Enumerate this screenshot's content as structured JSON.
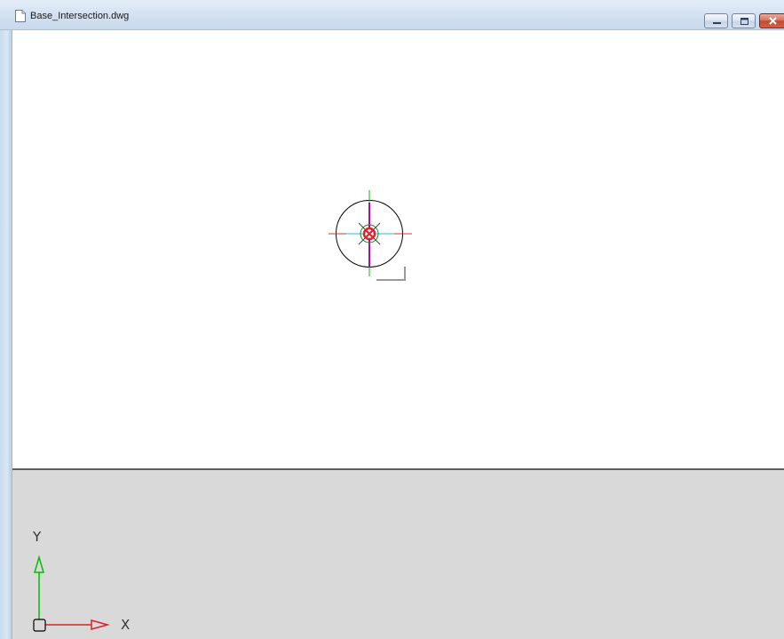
{
  "window": {
    "title": "Base_Intersection.dwg",
    "doc_icon": "document-icon",
    "controls": {
      "minimize_icon": "minimize-icon",
      "maximize_icon": "maximize-icon",
      "close_icon": "close-icon"
    }
  },
  "drawing": {
    "background": "#ffffff",
    "outer_circle_color": "#000000",
    "center_marker_color": "#e0202a",
    "crosshair_colors": {
      "vertical": "#00c000",
      "horizontal": "#e03030",
      "inner_vertical": "#c000c0",
      "inner_horizontal": "#00d0d0"
    }
  },
  "ucs": {
    "y_label": "Y",
    "x_label": "X",
    "y_axis_color": "#00c000",
    "x_axis_color": "#e02020",
    "panel_background": "#d9d9d9"
  }
}
